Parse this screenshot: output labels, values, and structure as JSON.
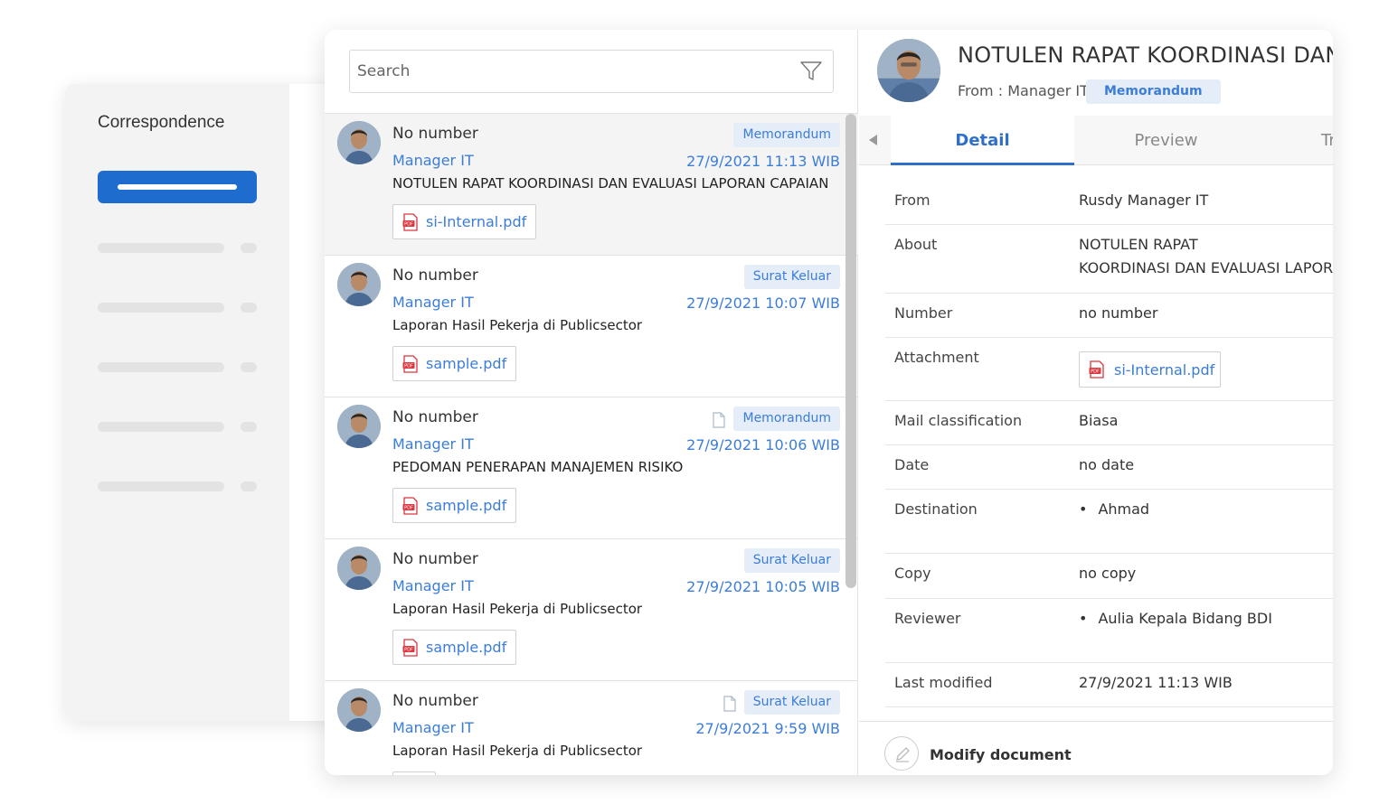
{
  "background_app": {
    "title": "Correspondence"
  },
  "search": {
    "placeholder": "Search"
  },
  "messages": [
    {
      "number": "No number",
      "sender": "Manager IT",
      "badge": "Memorandum",
      "date": "27/9/2021 11:13 WIB",
      "subject": "NOTULEN RAPAT KOORDINASI DAN EVALUASI LAPORAN CAPAIAN",
      "attachment": "si-Internal.pdf",
      "has_doc_icon": false,
      "selected": true
    },
    {
      "number": "No number",
      "sender": "Manager IT",
      "badge": "Surat Keluar",
      "date": "27/9/2021 10:07 WIB",
      "subject": "Laporan Hasil Pekerja di Publicsector",
      "attachment": "sample.pdf",
      "has_doc_icon": false,
      "selected": false
    },
    {
      "number": "No number",
      "sender": "Manager IT",
      "badge": "Memorandum",
      "date": "27/9/2021 10:06 WIB",
      "subject": "PEDOMAN PENERAPAN MANAJEMEN RISIKO",
      "attachment": "sample.pdf",
      "has_doc_icon": true,
      "selected": false
    },
    {
      "number": "No number",
      "sender": "Manager IT",
      "badge": "Surat Keluar",
      "date": "27/9/2021 10:05 WIB",
      "subject": "Laporan Hasil Pekerja di Publicsector",
      "attachment": "sample.pdf",
      "has_doc_icon": false,
      "selected": false
    },
    {
      "number": "No number",
      "sender": "Manager IT",
      "badge": "Surat Keluar",
      "date": "27/9/2021 9:59 WIB",
      "subject": "Laporan Hasil Pekerja di Publicsector",
      "attachment": "",
      "has_doc_icon": true,
      "selected": false
    }
  ],
  "detail": {
    "title": "NOTULEN RAPAT KOORDINASI DAN E",
    "from_line": "From : Manager IT",
    "badge": "Memorandum",
    "tabs": [
      "Detail",
      "Preview",
      "Tr"
    ],
    "active_tab": "Detail",
    "fields": {
      "from_label": "From",
      "from_value": "Rusdy Manager IT",
      "about_label": "About",
      "about_line1": "NOTULEN RAPAT",
      "about_line2": "KOORDINASI DAN EVALUASI LAPORAN",
      "number_label": "Number",
      "number_value": "no number",
      "attachment_label": "Attachment",
      "attachment_value": "si-Internal.pdf",
      "classification_label": "Mail classification",
      "classification_value": "Biasa",
      "date_label": "Date",
      "date_value": "no date",
      "destination_label": "Destination",
      "destination_value": "Ahmad",
      "copy_label": "Copy",
      "copy_value": "no copy",
      "reviewer_label": "Reviewer",
      "reviewer_value": "Aulia Kepala Bidang BDI",
      "modified_label": "Last modified",
      "modified_value": "27/9/2021 11:13 WIB"
    },
    "footer_action": "Modify document"
  },
  "colors": {
    "accent": "#2f6fc9",
    "link": "#3b7dd8",
    "badge_bg": "#e4edf8",
    "pdf_red": "#d9363e"
  }
}
